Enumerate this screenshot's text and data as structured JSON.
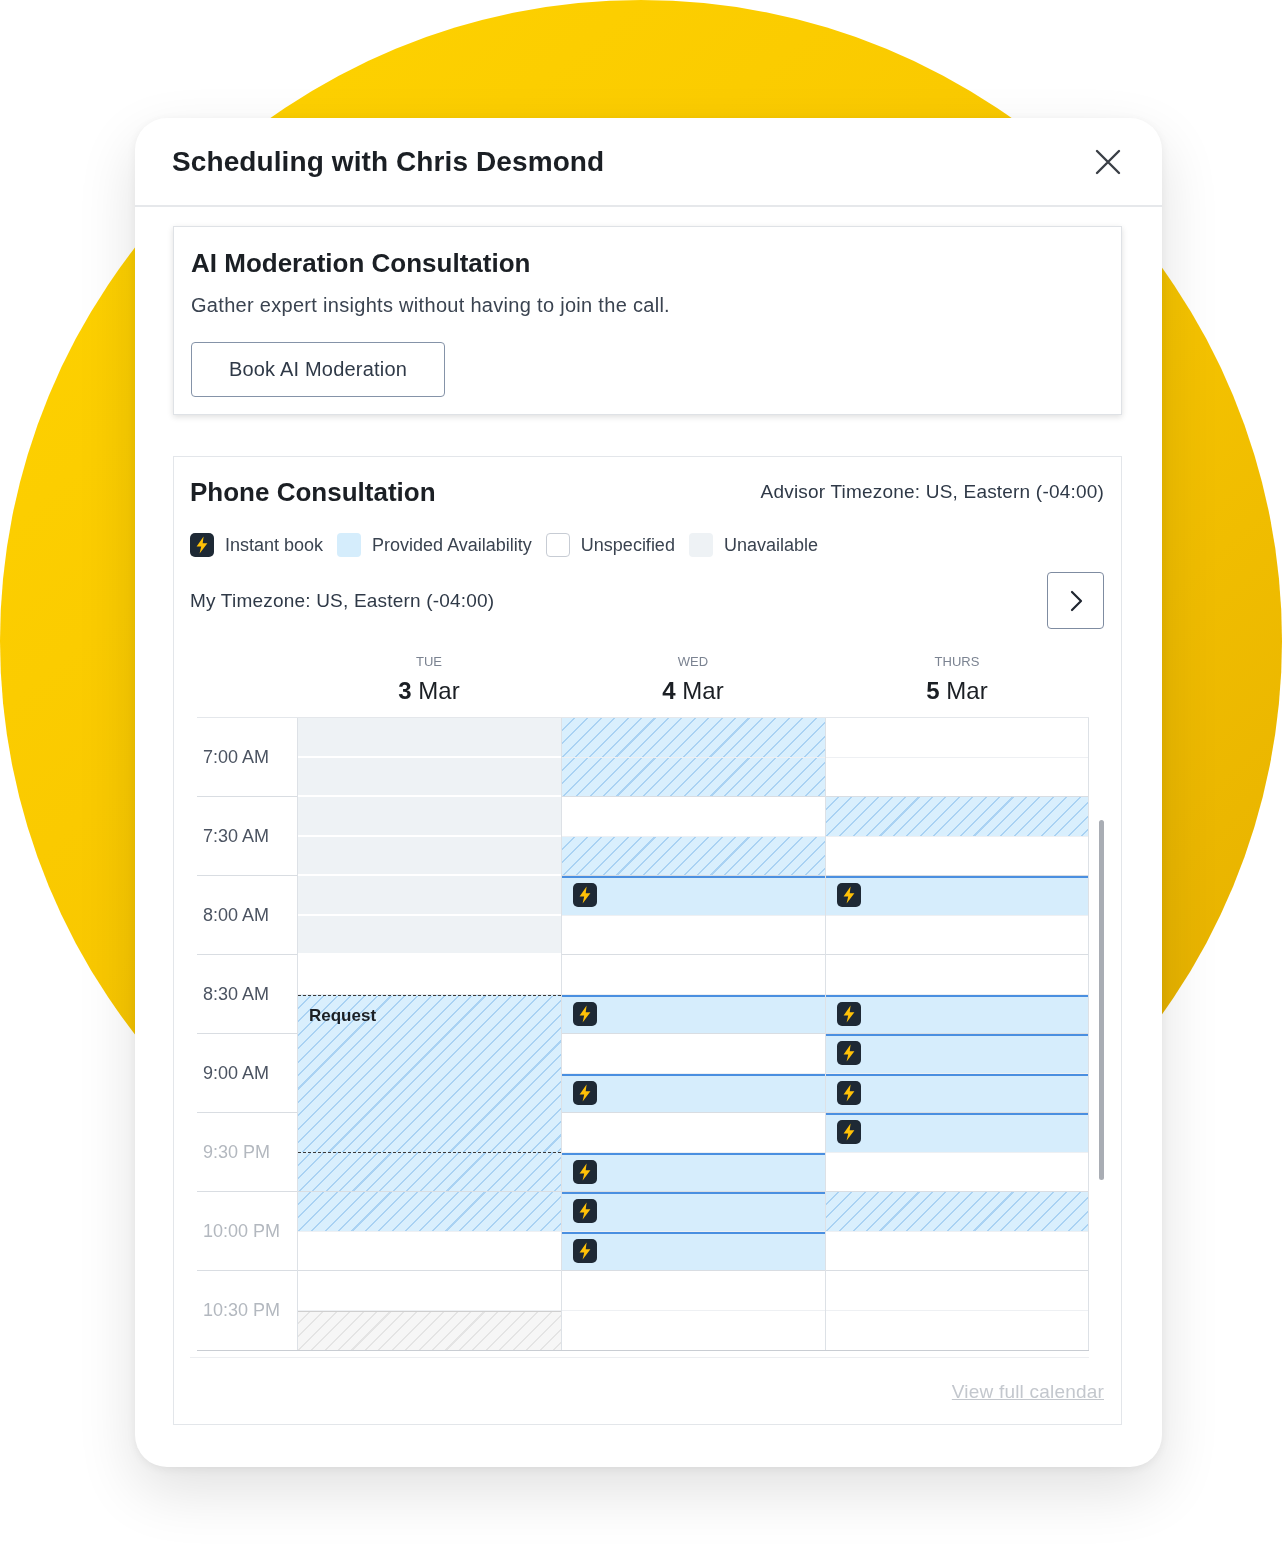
{
  "dialog": {
    "title": "Scheduling with Chris Desmond"
  },
  "ai_moderation": {
    "title": "AI Moderation Consultation",
    "description": "Gather expert insights without having to join the call.",
    "button": "Book AI Moderation"
  },
  "phone_consultation": {
    "title": "Phone Consultation",
    "advisor_timezone": "Advisor Timezone: US, Eastern (-04:00)",
    "legend": [
      {
        "kind": "instant",
        "label": "Instant book"
      },
      {
        "kind": "available",
        "label": "Provided Availability"
      },
      {
        "kind": "unspecified",
        "label": "Unspecified"
      },
      {
        "kind": "unavailable",
        "label": "Unavailable"
      }
    ],
    "my_timezone": "My Timezone: US, Eastern (-04:00)",
    "days": [
      {
        "weekday": "TUE",
        "date": "**3** Mar"
      },
      {
        "weekday": "WED",
        "date": "**4** Mar"
      },
      {
        "weekday": "THURS",
        "date": "**5** Mar"
      }
    ],
    "rows": [
      {
        "time": "7:00 AM",
        "dimmed": false,
        "cells": [
          [
            {
              "kind": "unavailable"
            },
            {
              "kind": "unavailable"
            }
          ],
          [
            {
              "kind": "available"
            },
            {
              "kind": "available"
            }
          ],
          [
            {
              "kind": "unspecified"
            },
            {
              "kind": "unspecified"
            }
          ]
        ]
      },
      {
        "time": "7:30 AM",
        "dimmed": false,
        "cells": [
          [
            {
              "kind": "unavailable"
            },
            {
              "kind": "unavailable"
            }
          ],
          [
            {
              "kind": "unspecified"
            },
            {
              "kind": "available"
            }
          ],
          [
            {
              "kind": "available"
            },
            {
              "kind": "unspecified"
            }
          ]
        ]
      },
      {
        "time": "8:00 AM",
        "dimmed": false,
        "cells": [
          [
            {
              "kind": "unavailable"
            },
            {
              "kind": "unavailable"
            }
          ],
          [
            {
              "kind": "instant"
            },
            {
              "kind": "unspecified"
            }
          ],
          [
            {
              "kind": "instant"
            },
            {
              "kind": "unspecified"
            }
          ]
        ]
      },
      {
        "time": "8:30 AM",
        "dimmed": false,
        "cells": [
          [
            {
              "kind": "unspecified"
            },
            {
              "kind": "request",
              "label": "Request"
            }
          ],
          [
            {
              "kind": "unspecified"
            },
            {
              "kind": "instant"
            }
          ],
          [
            {
              "kind": "unspecified"
            },
            {
              "kind": "instant"
            }
          ]
        ]
      },
      {
        "time": "9:00 AM",
        "dimmed": false,
        "cells": [
          [
            {
              "kind": "request"
            },
            {
              "kind": "request"
            }
          ],
          [
            {
              "kind": "unspecified"
            },
            {
              "kind": "instant"
            }
          ],
          [
            {
              "kind": "instant"
            },
            {
              "kind": "instant"
            }
          ]
        ]
      },
      {
        "time": "9:30 PM",
        "dimmed": true,
        "cells": [
          [
            {
              "kind": "request"
            },
            {
              "kind": "available"
            }
          ],
          [
            {
              "kind": "unspecified"
            },
            {
              "kind": "instant"
            }
          ],
          [
            {
              "kind": "instant"
            },
            {
              "kind": "unspecified"
            }
          ]
        ]
      },
      {
        "time": "10:00 PM",
        "dimmed": true,
        "cells": [
          [
            {
              "kind": "available"
            },
            {
              "kind": "unspecified"
            }
          ],
          [
            {
              "kind": "instant"
            },
            {
              "kind": "instant"
            }
          ],
          [
            {
              "kind": "available"
            },
            {
              "kind": "unspecified"
            }
          ]
        ]
      },
      {
        "time": "10:30 PM",
        "dimmed": true,
        "cells": [
          [
            {
              "kind": "unspecified"
            },
            {
              "kind": "blocked"
            }
          ],
          [
            {
              "kind": "unspecified"
            },
            {
              "kind": "unspecified"
            }
          ],
          [
            {
              "kind": "unspecified"
            },
            {
              "kind": "unspecified"
            }
          ]
        ]
      }
    ],
    "link": "View full calendar"
  }
}
